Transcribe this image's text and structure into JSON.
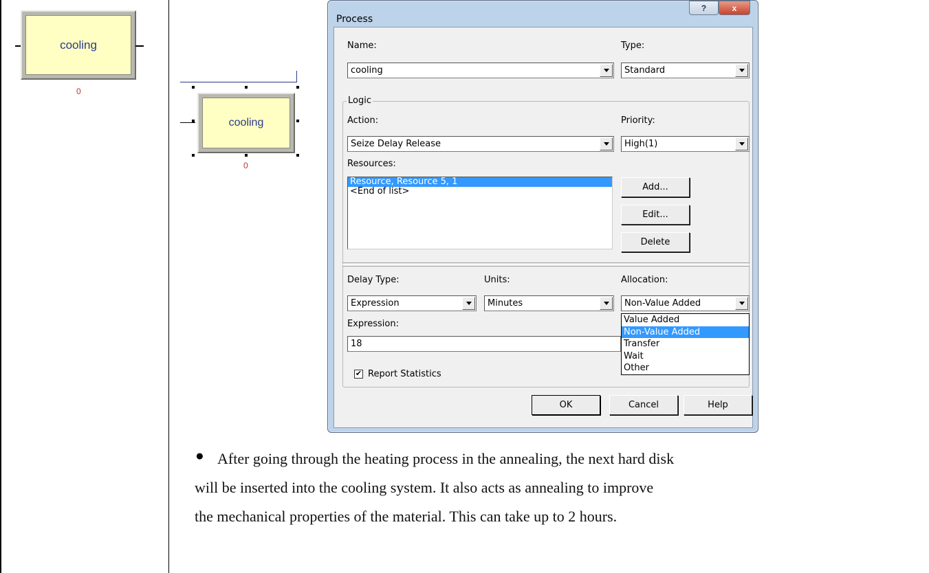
{
  "modules": {
    "left": {
      "label": "cooling",
      "counter": "0"
    },
    "right": {
      "label": "cooling",
      "counter": "0"
    }
  },
  "dialog": {
    "title": "Process",
    "help_glyph": "?",
    "close_glyph": "x",
    "name_label": "Name:",
    "name_value": "cooling",
    "type_label": "Type:",
    "type_value": "Standard",
    "logic_label": "Logic",
    "action_label": "Action:",
    "action_value": "Seize Delay Release",
    "priority_label": "Priority:",
    "priority_value": "High(1)",
    "resources_label": "Resources:",
    "resources": [
      "Resource, Resource 5, 1",
      "<End of list>"
    ],
    "add_button": "Add...",
    "edit_button": "Edit...",
    "delete_button": "Delete",
    "delay_type_label": "Delay Type:",
    "delay_type_value": "Expression",
    "units_label": "Units:",
    "units_value": "Minutes",
    "allocation_label": "Allocation:",
    "allocation_value": "Non-Value Added",
    "allocation_options": [
      "Value Added",
      "Non-Value Added",
      "Transfer",
      "Wait",
      "Other"
    ],
    "expression_label": "Expression:",
    "expression_value": "18",
    "report_statistics_label": "Report Statistics",
    "report_statistics_checked": "✔",
    "ok_button": "OK",
    "cancel_button": "Cancel",
    "help_button": "Help"
  },
  "body_text": {
    "bullet": "●",
    "line1": "After going through the heating process in the annealing, the next hard disk",
    "line2": "will be inserted into the cooling system. It also acts as annealing to improve",
    "line3": "the mechanical properties of the material. This can take up to 2 hours."
  },
  "colors": {
    "module_fill": "#ffffc4",
    "selection": "#3399ff",
    "counter": "#c0312e",
    "close_button": "#c7432d"
  }
}
